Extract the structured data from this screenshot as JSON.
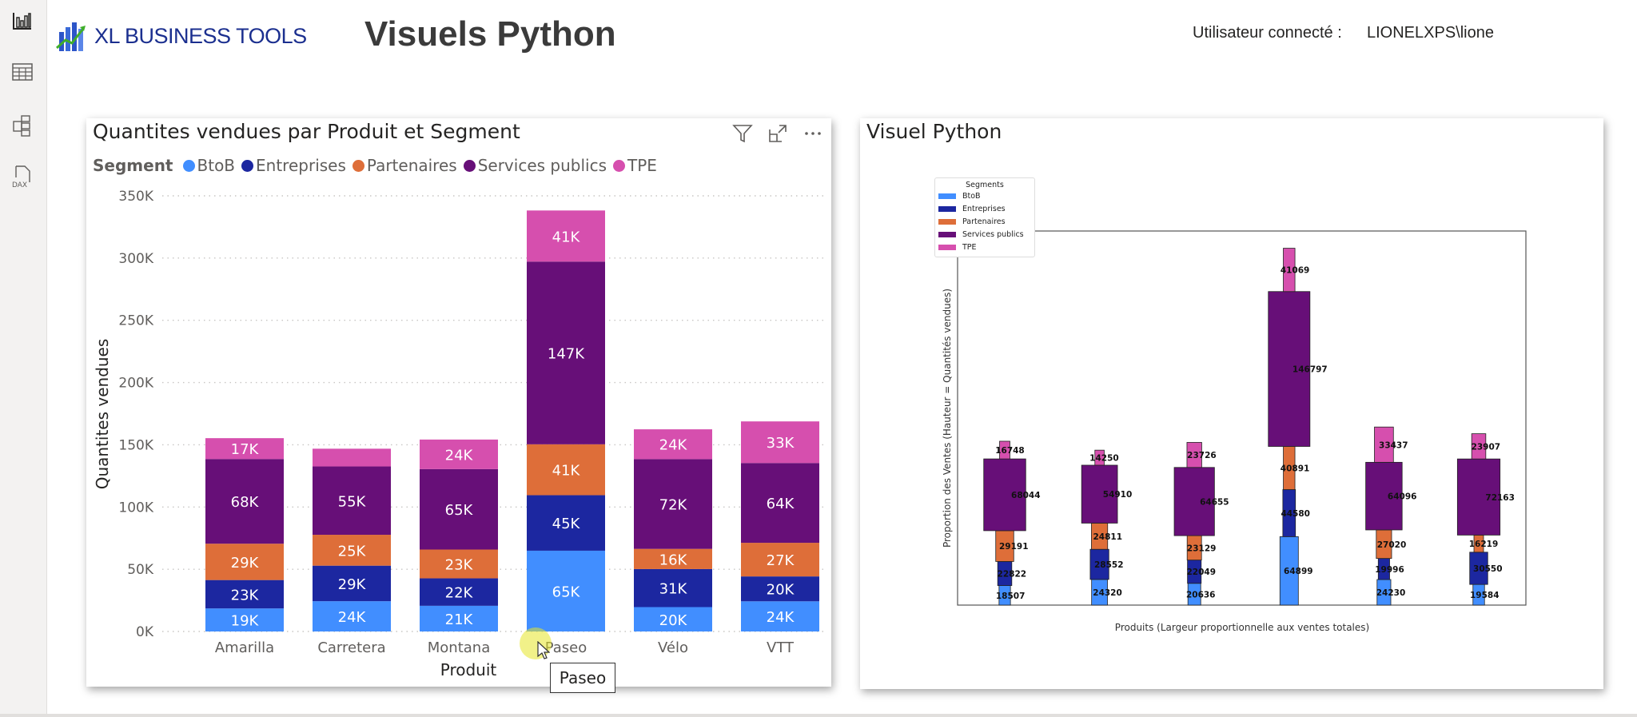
{
  "header": {
    "logo_text": "XL BUSINESS TOOLS",
    "page_title": "Visuels Python",
    "user_label": "Utilisateur connecté :",
    "user_value": "LIONELXPS\\lione"
  },
  "sidebar": {
    "items": [
      {
        "icon": "report-view-icon"
      },
      {
        "icon": "table-view-icon"
      },
      {
        "icon": "model-view-icon"
      },
      {
        "icon": "dax-query-icon",
        "label": "DAX"
      }
    ]
  },
  "colors": {
    "BtoB": "#418EFF",
    "Entreprises": "#1C27A0",
    "Partenaires": "#DE6E39",
    "Services publics": "#670F78",
    "TPE": "#D64FAE"
  },
  "chart_data": [
    {
      "type": "bar",
      "stacked": true,
      "title": "Quantites vendues par Produit et Segment",
      "legend_title": "Segment",
      "legend_position": "top-left",
      "xlabel": "Produit",
      "ylabel": "Quantites vendues",
      "ylim": [
        0,
        350000
      ],
      "yticks": [
        "0K",
        "50K",
        "100K",
        "150K",
        "200K",
        "250K",
        "300K",
        "350K"
      ],
      "grid": true,
      "categories": [
        "Amarilla",
        "Carretera",
        "Montana",
        "Paseo",
        "Vélo",
        "VTT"
      ],
      "series": [
        {
          "name": "BtoB",
          "values": [
            18507,
            24320,
            20636,
            64899,
            19584,
            24230
          ]
        },
        {
          "name": "Entreprises",
          "values": [
            22822,
            28552,
            22049,
            44580,
            30550,
            19996
          ]
        },
        {
          "name": "Partenaires",
          "values": [
            29191,
            24811,
            23129,
            40891,
            16219,
            27020
          ]
        },
        {
          "name": "Services publics",
          "values": [
            68044,
            54910,
            64655,
            146797,
            72163,
            64096
          ]
        },
        {
          "name": "TPE",
          "values": [
            16748,
            14250,
            23726,
            41069,
            23907,
            33437
          ]
        }
      ],
      "tooltip": "Paseo"
    },
    {
      "type": "bar",
      "stacked": true,
      "title": "Visuel Python",
      "legend_title": "Segments",
      "legend_position": "top-left",
      "xlabel": "Produits (Largeur proportionnelle aux ventes totales)",
      "ylabel": "Proportion des Ventes (Hauteur = Quantités vendues)",
      "grid": false,
      "series": [
        {
          "name": "BtoB",
          "values": [
            18507,
            24320,
            20636,
            64899,
            24230,
            19584
          ]
        },
        {
          "name": "Entreprises",
          "values": [
            22822,
            28552,
            22049,
            44580,
            19996,
            30550
          ]
        },
        {
          "name": "Partenaires",
          "values": [
            29191,
            24811,
            23129,
            40891,
            27020,
            16219
          ]
        },
        {
          "name": "Services publics",
          "values": [
            68044,
            54910,
            64655,
            146797,
            64096,
            72163
          ]
        },
        {
          "name": "TPE",
          "values": [
            16748,
            14250,
            23726,
            41069,
            33437,
            23907
          ]
        }
      ]
    }
  ]
}
